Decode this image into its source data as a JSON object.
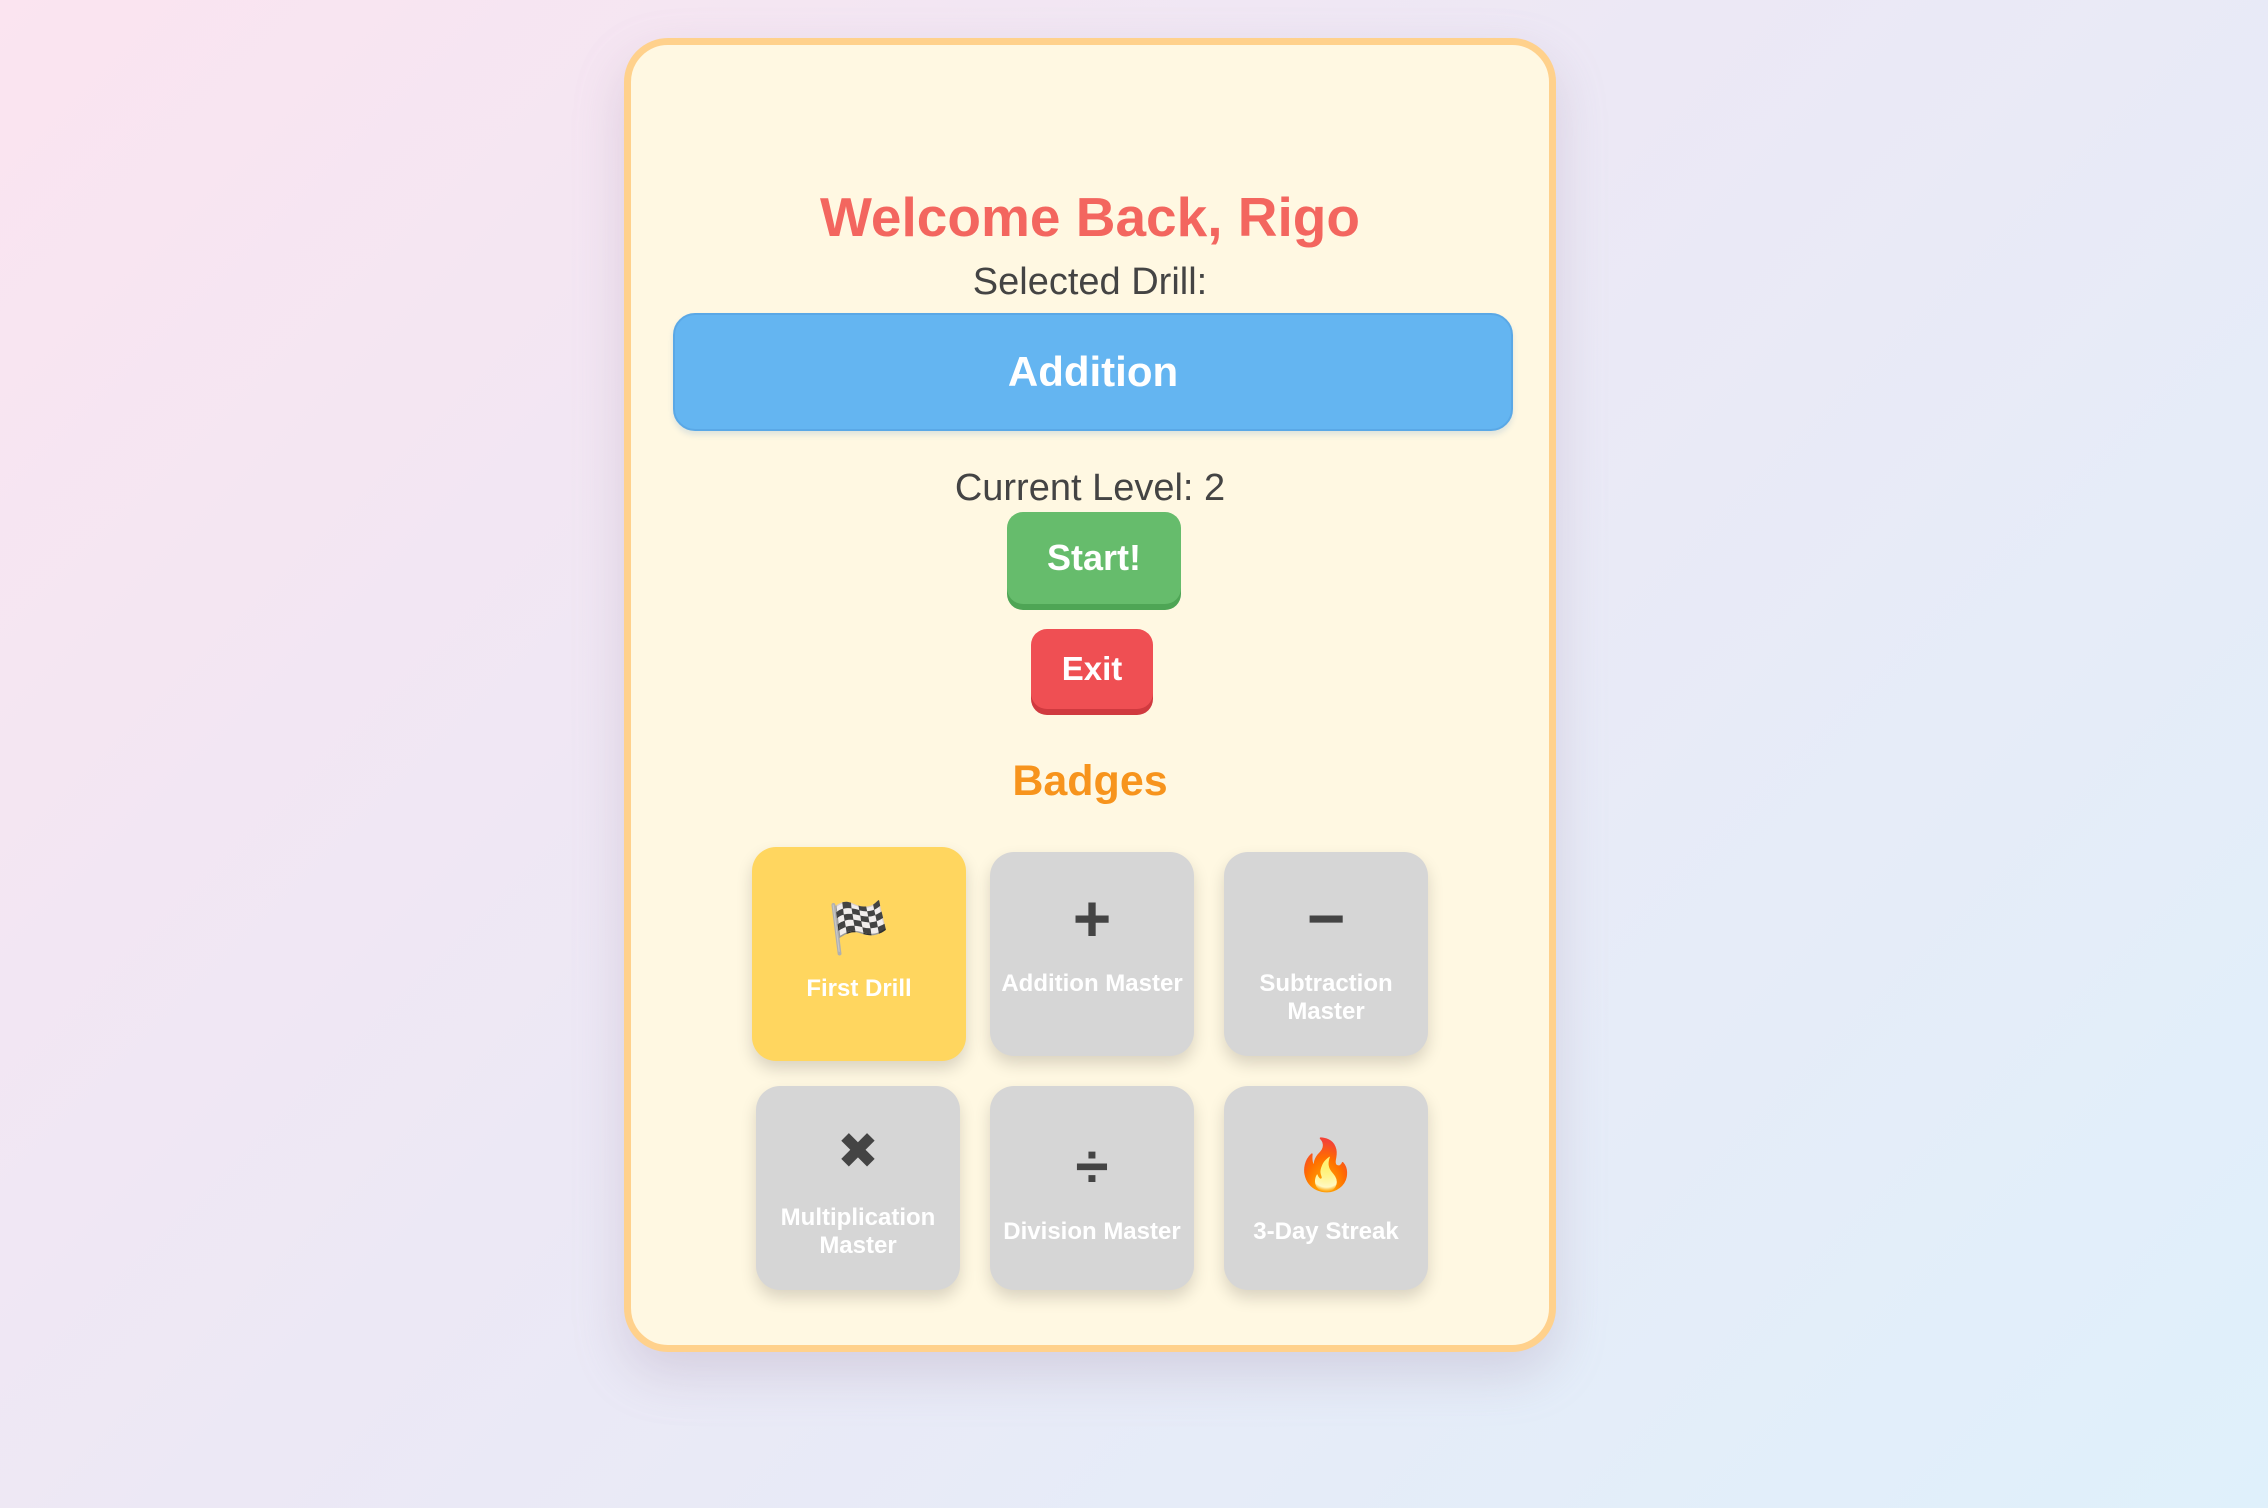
{
  "header": {
    "welcome": "Welcome Back, Rigo",
    "selected_drill_label": "Selected Drill:"
  },
  "drill": {
    "name": "Addition"
  },
  "level": {
    "text": "Current Level: 2",
    "value": 2
  },
  "actions": {
    "start_label": "Start!",
    "exit_label": "Exit"
  },
  "badges": {
    "title": "Badges",
    "items": [
      {
        "icon": "🏁",
        "icon_name": "checkered-flag-icon",
        "label": "First Drill",
        "earned": true
      },
      {
        "icon": "+",
        "icon_name": "plus-icon",
        "label": "Addition Master",
        "earned": false
      },
      {
        "icon": "−",
        "icon_name": "minus-icon",
        "label": "Subtraction Master",
        "earned": false
      },
      {
        "icon": "✖",
        "icon_name": "multiply-icon",
        "label": "Multiplication Master",
        "earned": false
      },
      {
        "icon": "÷",
        "icon_name": "divide-icon",
        "label": "Division Master",
        "earned": false
      },
      {
        "icon": "🔥",
        "icon_name": "fire-icon",
        "label": "3-Day Streak",
        "earned": false
      }
    ]
  },
  "colors": {
    "title": "#f3665f",
    "drill_button": "#64b5f1",
    "start_button": "#66bc6c",
    "exit_button": "#ef4f53",
    "badges_title": "#f7941d",
    "badge_earned": "#ffd65f",
    "badge_locked": "#d6d6d6",
    "card_background": "#fff8e2",
    "card_border": "#ffd18c"
  }
}
